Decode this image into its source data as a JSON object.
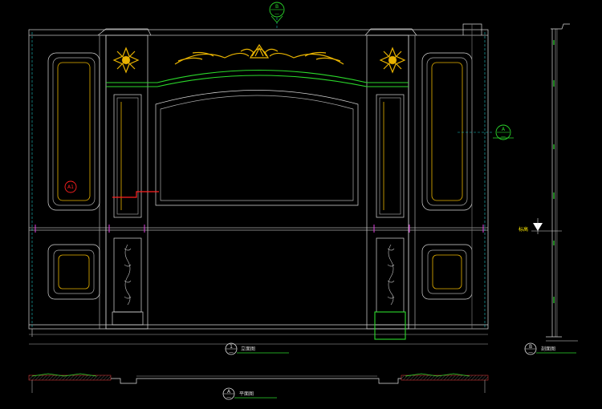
{
  "drawing": {
    "background": "#000000",
    "colors": {
      "frame": "#ffffff",
      "panel": "#d8d8d8",
      "gold": "#e8b300",
      "green": "#2bd92b",
      "red": "#ff2020",
      "magenta": "#e03ce0",
      "cyan": "#19c2c2",
      "grey": "#8a8a8a"
    },
    "markers": {
      "top_section": {
        "letter": "B",
        "sub": "—"
      },
      "side_section": {
        "letter": "A",
        "sub": "—"
      },
      "room_tag": "A1"
    },
    "titles": {
      "main_elevation": {
        "number": "1",
        "sub": "—",
        "text": "立面图"
      },
      "side_section": {
        "letter": "B",
        "sub": "—",
        "text": "剖面图"
      },
      "plan_section": {
        "letter": "A",
        "sub": "—",
        "text": "平面图"
      }
    },
    "level_tag": "标高",
    "icons": [
      "section-marker-icon",
      "elevation-level-icon",
      "ornament-icon"
    ]
  }
}
